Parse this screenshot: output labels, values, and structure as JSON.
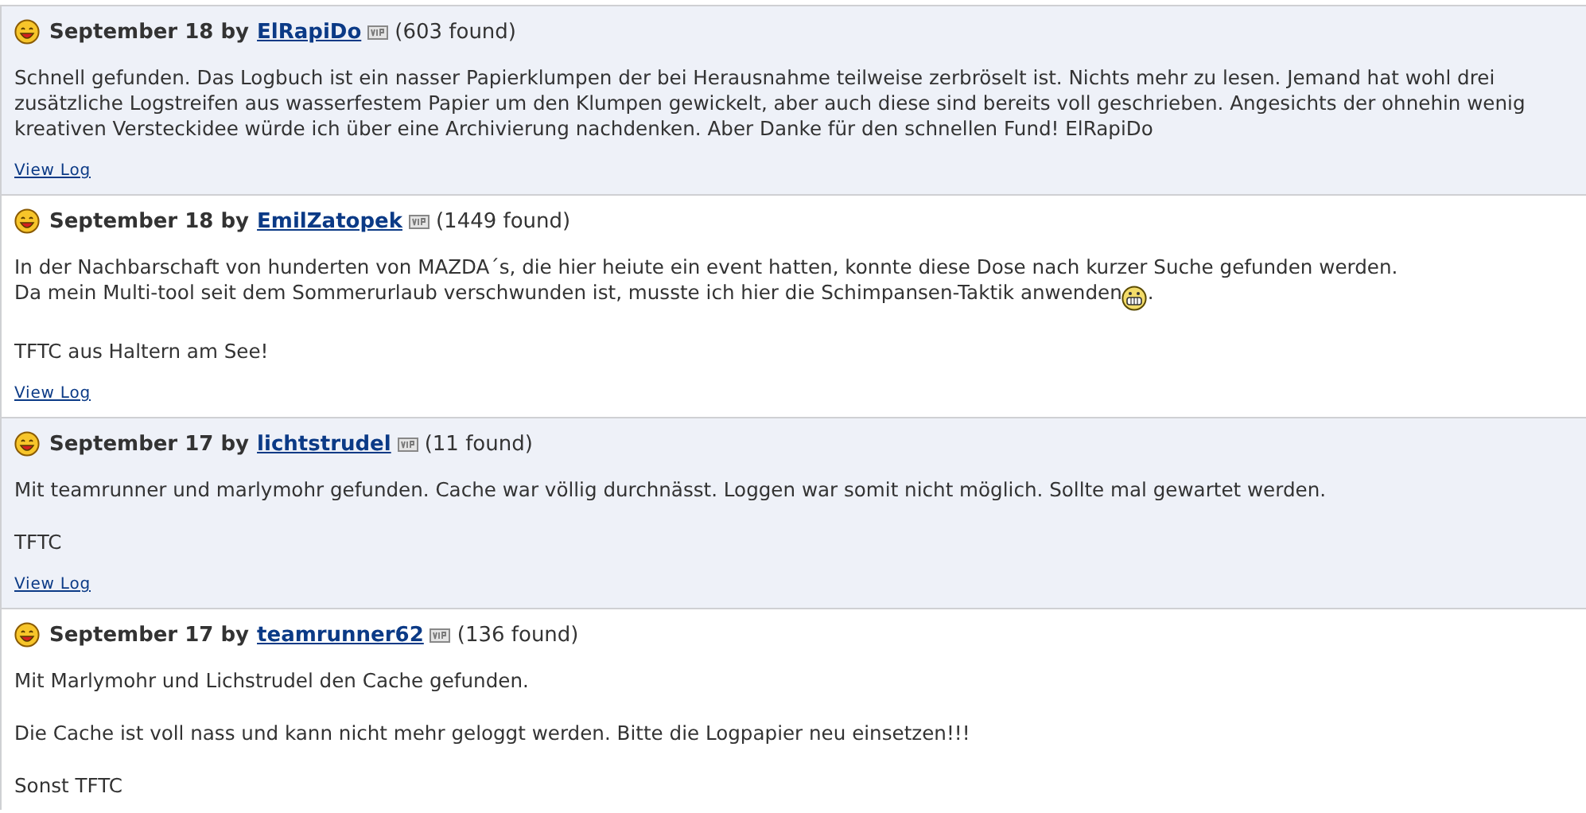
{
  "logs": [
    {
      "date": "September 18",
      "by": "by",
      "user": "ElRapiDo",
      "vip": true,
      "found": "(603 found)",
      "shaded": true,
      "paragraphs": [
        [
          "Schnell gefunden. Das Logbuch ist ein nasser Papierklumpen der bei Herausnahme teilweise zerbröselt ist. Nichts mehr zu lesen. Jemand hat wohl drei zusätzliche Logstreifen aus wasserfestem Papier um den Klumpen gewickelt, aber auch diese sind bereits voll geschrieben. Angesichts der ohnehin wenig kreativen Versteckidee würde ich über eine Archivierung nachdenken. Aber Danke für den schnellen Fund! ElRapiDo"
        ]
      ],
      "view_log": "View Log"
    },
    {
      "date": "September 18",
      "by": "by",
      "user": "EmilZatopek",
      "vip": true,
      "found": "(1449 found)",
      "shaded": false,
      "paragraphs": [
        [
          "In der Nachbarschaft von hunderten von MAZDA´s, die hier heiute ein event hatten, konnte diese Dose nach kurzer Suche gefunden werden.",
          [
            {
              "kind": "text",
              "text": "Da mein Multi-tool seit dem Sommerurlaub verschwunden ist, musste ich hier die Schimpansen-Taktik anwenden"
            },
            {
              "kind": "grin"
            },
            {
              "kind": "text",
              "text": "."
            }
          ]
        ],
        [
          "TFTC aus Haltern am See!"
        ]
      ],
      "view_log": "View Log"
    },
    {
      "date": "September 17",
      "by": "by",
      "user": "lichtstrudel",
      "vip": true,
      "found": "(11 found)",
      "shaded": true,
      "paragraphs": [
        [
          "Mit teamrunner und marlymohr gefunden. Cache war völlig durchnässt. Loggen war somit nicht möglich. Sollte mal gewartet werden."
        ],
        [
          "TFTC"
        ]
      ],
      "view_log": "View Log"
    },
    {
      "date": "September 17",
      "by": "by",
      "user": "teamrunner62",
      "vip": true,
      "found": "(136 found)",
      "shaded": false,
      "paragraphs": [
        [
          "Mit Marlymohr und Lichstrudel den Cache gefunden."
        ],
        [
          "Die Cache ist voll nass und kann nicht mehr geloggt werden. Bitte die Logpapier neu einsetzen!!!"
        ],
        [
          "Sonst TFTC"
        ]
      ]
    }
  ]
}
